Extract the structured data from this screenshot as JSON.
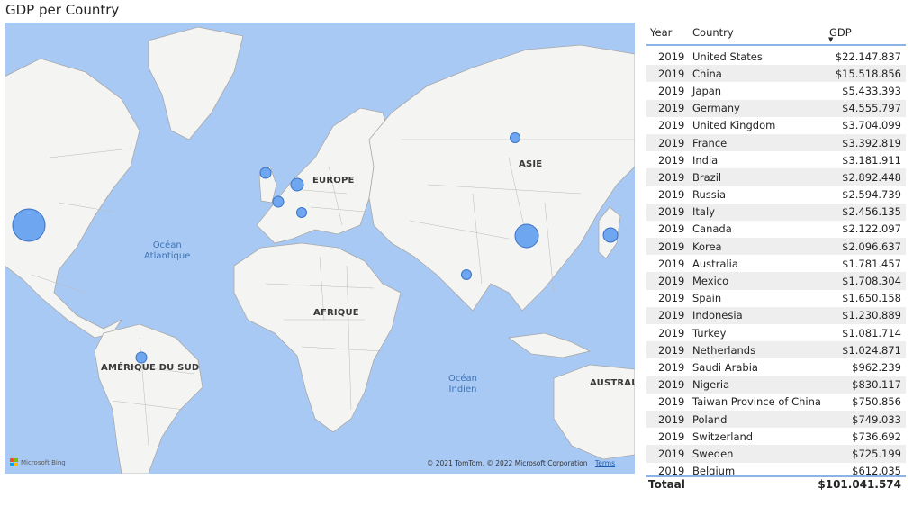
{
  "visual": {
    "title": "GDP per Country"
  },
  "map": {
    "continent_labels": [
      "EUROPE",
      "ASIE",
      "AFRIQUE",
      "AMÉRIQUE DU SUD",
      "AUSTRAL"
    ],
    "ocean_labels": [
      {
        "line1": "Océan",
        "line2": "Atlantique"
      },
      {
        "line1": "Océan",
        "line2": "Indien"
      }
    ],
    "attribution": "Microsoft Bing",
    "copyright": "© 2021 TomTom, © 2022 Microsoft Corporation",
    "terms": "Terms",
    "bubble_color": "#6ea7f0",
    "land_color": "#f4f4f2",
    "water_color": "#a9c9f5"
  },
  "table": {
    "headers": {
      "year": "Year",
      "country": "Country",
      "gdp": "GDP"
    },
    "sort_indicator": "▼",
    "rows": [
      {
        "year": "2019",
        "country": "United States",
        "gdp": "$22.147.837"
      },
      {
        "year": "2019",
        "country": "China",
        "gdp": "$15.518.856"
      },
      {
        "year": "2019",
        "country": "Japan",
        "gdp": "$5.433.393"
      },
      {
        "year": "2019",
        "country": "Germany",
        "gdp": "$4.555.797"
      },
      {
        "year": "2019",
        "country": "United Kingdom",
        "gdp": "$3.704.099"
      },
      {
        "year": "2019",
        "country": "France",
        "gdp": "$3.392.819"
      },
      {
        "year": "2019",
        "country": "India",
        "gdp": "$3.181.911"
      },
      {
        "year": "2019",
        "country": "Brazil",
        "gdp": "$2.892.448"
      },
      {
        "year": "2019",
        "country": "Russia",
        "gdp": "$2.594.739"
      },
      {
        "year": "2019",
        "country": "Italy",
        "gdp": "$2.456.135"
      },
      {
        "year": "2019",
        "country": "Canada",
        "gdp": "$2.122.097"
      },
      {
        "year": "2019",
        "country": "Korea",
        "gdp": "$2.096.637"
      },
      {
        "year": "2019",
        "country": "Australia",
        "gdp": "$1.781.457"
      },
      {
        "year": "2019",
        "country": "Mexico",
        "gdp": "$1.708.304"
      },
      {
        "year": "2019",
        "country": "Spain",
        "gdp": "$1.650.158"
      },
      {
        "year": "2019",
        "country": "Indonesia",
        "gdp": "$1.230.889"
      },
      {
        "year": "2019",
        "country": "Turkey",
        "gdp": "$1.081.714"
      },
      {
        "year": "2019",
        "country": "Netherlands",
        "gdp": "$1.024.871"
      },
      {
        "year": "2019",
        "country": "Saudi Arabia",
        "gdp": "$962.239"
      },
      {
        "year": "2019",
        "country": "Nigeria",
        "gdp": "$830.117"
      },
      {
        "year": "2019",
        "country": "Taiwan Province of China",
        "gdp": "$750.856"
      },
      {
        "year": "2019",
        "country": "Poland",
        "gdp": "$749.033"
      },
      {
        "year": "2019",
        "country": "Switzerland",
        "gdp": "$736.692"
      },
      {
        "year": "2019",
        "country": "Sweden",
        "gdp": "$725.199"
      },
      {
        "year": "2019",
        "country": "Belgium",
        "gdp": "$612.035"
      }
    ],
    "total_label": "Totaal",
    "total_value": "$101.041.574"
  }
}
